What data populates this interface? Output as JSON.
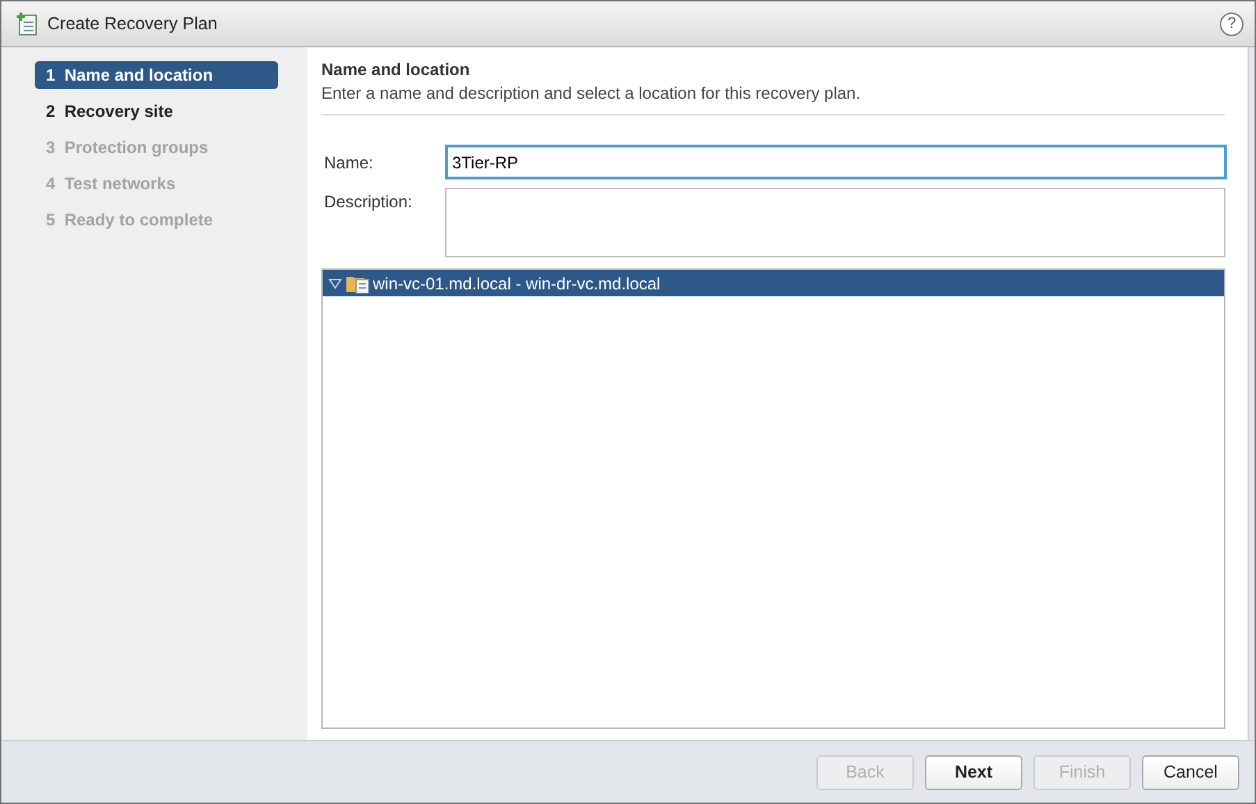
{
  "window": {
    "title": "Create Recovery Plan",
    "help": "?"
  },
  "steps": [
    {
      "label": "1  Name and location",
      "selected": true,
      "disabled": false
    },
    {
      "label": "2  Recovery site",
      "selected": false,
      "disabled": false
    },
    {
      "label": "3  Protection groups",
      "selected": false,
      "disabled": true
    },
    {
      "label": "4  Test networks",
      "selected": false,
      "disabled": true
    },
    {
      "label": "5  Ready to complete",
      "selected": false,
      "disabled": true
    }
  ],
  "page": {
    "heading": "Name and location",
    "description": "Enter a name and description and select a location for this recovery plan."
  },
  "form": {
    "name_label": "Name:",
    "name_value": "3Tier-RP",
    "description_label": "Description:"
  },
  "tree": [
    {
      "label": "win-vc-01.md.local - win-dr-vc.md.local",
      "expanded": true,
      "selected": true
    }
  ],
  "buttons": [
    {
      "label": "Back",
      "disabled": true,
      "primary": false
    },
    {
      "label": "Next",
      "disabled": false,
      "primary": true
    },
    {
      "label": "Finish",
      "disabled": true,
      "primary": false
    },
    {
      "label": "Cancel",
      "disabled": false,
      "primary": false
    }
  ]
}
